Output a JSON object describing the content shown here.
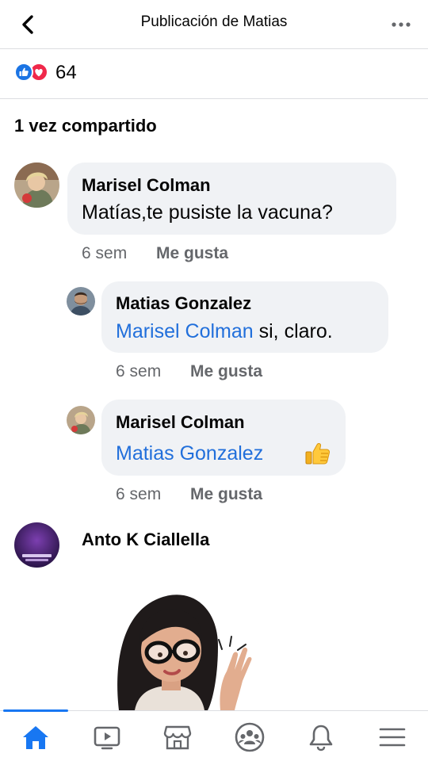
{
  "header": {
    "title": "Publicación de Matias",
    "back_icon": "chevron-left-icon",
    "more_icon": "more-horizontal-icon"
  },
  "reactions": {
    "count": "64",
    "types": [
      "like",
      "love"
    ],
    "colors": {
      "like": "#1b74e4",
      "love": "#f0284a"
    }
  },
  "shares": {
    "label": "1 vez compartido"
  },
  "comments": [
    {
      "author": "Marisel Colman",
      "text": "Matías,te pusiste la vacuna?",
      "time": "6 sem",
      "like_label": "Me gusta"
    },
    {
      "author": "Matias Gonzalez",
      "mention": "Marisel Colman",
      "text": " si, claro.",
      "time": "6 sem",
      "like_label": "Me gusta"
    },
    {
      "author": "Marisel Colman",
      "mention": "Matias Gonzalez",
      "text": "",
      "emoji": "👍",
      "time": "6 sem",
      "like_label": "Me gusta"
    },
    {
      "author": "Anto K Ciallella",
      "sticker": "avatar-sticker-woman-glasses-waving"
    }
  ],
  "nav": {
    "items": [
      "home-icon",
      "watch-icon",
      "marketplace-icon",
      "groups-icon",
      "notifications-icon",
      "menu-icon"
    ],
    "active": "home-icon",
    "accent": "#1877f2"
  }
}
